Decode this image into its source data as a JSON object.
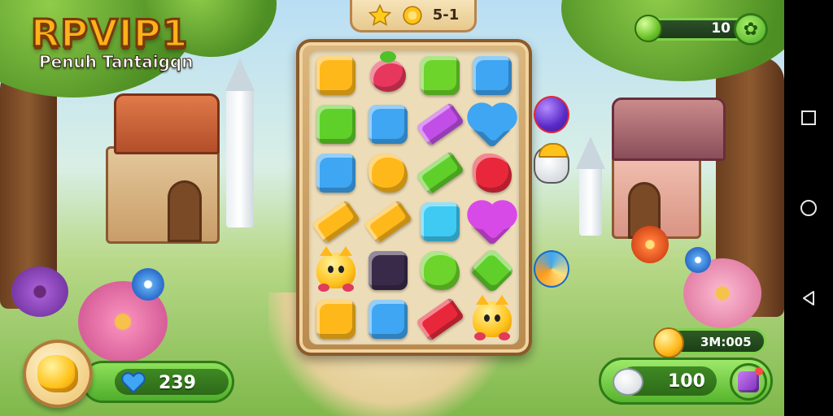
{
  "header": {
    "title": "RPVIP1",
    "subtitle": "Penuh Tantaigqn"
  },
  "level": {
    "label": "5-1",
    "star_icon": "star-icon",
    "coin_icon": "coin-icon"
  },
  "top_right": {
    "value": "10",
    "left_icon": "green-orb-icon",
    "button_icon": "clover-icon"
  },
  "board": {
    "rows": [
      [
        {
          "kind": "gem",
          "shape": "square",
          "color": "#ffb81a"
        },
        {
          "kind": "gem",
          "shape": "berry",
          "color": "#e8375c"
        },
        {
          "kind": "gem",
          "shape": "square",
          "color": "#6cd42a"
        },
        {
          "kind": "gem",
          "shape": "square",
          "color": "#3ea6f2"
        }
      ],
      [
        {
          "kind": "gem",
          "shape": "square",
          "color": "#5fd02a"
        },
        {
          "kind": "gem",
          "shape": "square",
          "color": "#3ea6f2"
        },
        {
          "kind": "gem",
          "shape": "rect",
          "color": "#c24ee8"
        },
        {
          "kind": "gem",
          "shape": "heart",
          "color": "#3ea6f2"
        }
      ],
      [
        {
          "kind": "gem",
          "shape": "square",
          "color": "#3ea6f2"
        },
        {
          "kind": "gem",
          "shape": "blob",
          "color": "#ffb81a"
        },
        {
          "kind": "gem",
          "shape": "rect",
          "color": "#5fd02a"
        },
        {
          "kind": "gem",
          "shape": "blob",
          "color": "#e8283a"
        }
      ],
      [
        {
          "kind": "gem",
          "shape": "rect",
          "color": "#ffb81a"
        },
        {
          "kind": "gem",
          "shape": "rect",
          "color": "#ffb81a"
        },
        {
          "kind": "gem",
          "shape": "square",
          "color": "#3ecaf2"
        },
        {
          "kind": "gem",
          "shape": "heart",
          "color": "#d84ae8"
        }
      ],
      [
        {
          "kind": "creature",
          "color": "#ffc21a"
        },
        {
          "kind": "gem",
          "shape": "square",
          "color": "#3a2a4a"
        },
        {
          "kind": "gem",
          "shape": "blob",
          "color": "#6cd42a"
        },
        {
          "kind": "gem",
          "shape": "diamond",
          "color": "#5fd02a"
        }
      ],
      [
        {
          "kind": "gem",
          "shape": "square",
          "color": "#ffb81a"
        },
        {
          "kind": "gem",
          "shape": "square",
          "color": "#3ea6f2"
        },
        {
          "kind": "gem",
          "shape": "rect",
          "color": "#e8283a"
        },
        {
          "kind": "creature",
          "color": "#ffc21a"
        }
      ]
    ]
  },
  "side_blockers": [
    {
      "name": "purple-blob-blocker",
      "color": "#7a3ae8"
    },
    {
      "name": "robot-blocker",
      "color": "#e8e8e8"
    },
    {
      "name": "swirl-candy-blocker",
      "color": "#3ea6f2"
    }
  ],
  "bottom_left": {
    "value": "239",
    "chest_icon": "gold-chest-icon",
    "gem_icon": "blue-heart-gem-icon"
  },
  "bottom_right": {
    "score": "3M:005",
    "value": "100",
    "coin_icon": "gold-coin-icon",
    "pet_icon": "dog-icon",
    "shop_icon": "gift-box-icon"
  },
  "navbar": {
    "items": [
      {
        "name": "recent-apps-button",
        "glyph": "□"
      },
      {
        "name": "home-button",
        "glyph": "○"
      },
      {
        "name": "back-button",
        "glyph": "◁"
      }
    ]
  }
}
